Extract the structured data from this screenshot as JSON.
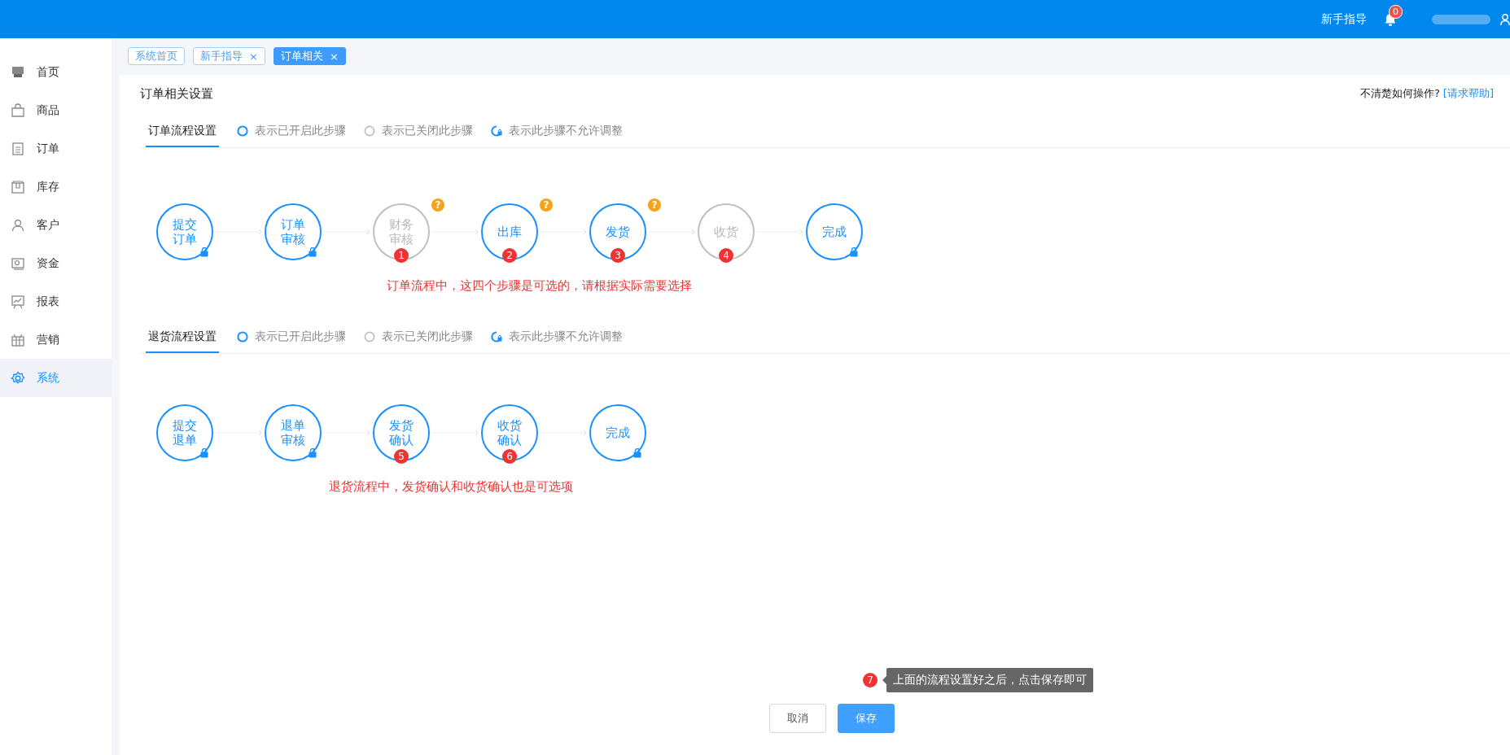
{
  "top_bar": {
    "guide_link": "新手指导",
    "notification_count": "0"
  },
  "sidebar": {
    "items": [
      {
        "label": "首页",
        "selected": false
      },
      {
        "label": "商品",
        "selected": false
      },
      {
        "label": "订单",
        "selected": false
      },
      {
        "label": "库存",
        "selected": false
      },
      {
        "label": "客户",
        "selected": false
      },
      {
        "label": "资金",
        "selected": false
      },
      {
        "label": "报表",
        "selected": false
      },
      {
        "label": "营销",
        "selected": false
      },
      {
        "label": "系统",
        "selected": true
      }
    ]
  },
  "page_tabs": [
    {
      "label": "系统首页",
      "selected": false
    },
    {
      "label": "新手指导",
      "selected": false,
      "close": "×"
    },
    {
      "label": "订单相关",
      "selected": true,
      "close": "×"
    }
  ],
  "title": "订单相关设置",
  "help": {
    "text": "不清楚如何操作?",
    "link": "[请求帮助]"
  },
  "sections": [
    {
      "tab": "订单流程设置",
      "legend": [
        {
          "kind": "on",
          "label": "表示已开启此步骤"
        },
        {
          "kind": "off",
          "label": "表示已关闭此步骤"
        },
        {
          "kind": "locked",
          "label": "表示此步骤不允许调整"
        }
      ],
      "steps": [
        {
          "label": "提交订单",
          "on": true,
          "locked": true
        },
        {
          "label": "订单审核",
          "on": true,
          "locked": true
        },
        {
          "label": "财务审核",
          "on": false,
          "locked": false,
          "help_badge": "?",
          "marker": "1"
        },
        {
          "label": "出库",
          "on": true,
          "locked": false,
          "help_badge": "?",
          "marker": "2"
        },
        {
          "label": "发货",
          "on": true,
          "locked": false,
          "help_badge": "?",
          "marker": "3"
        },
        {
          "label": "收货",
          "on": false,
          "locked": false,
          "marker": "4"
        },
        {
          "label": "完成",
          "on": true,
          "locked": true
        }
      ],
      "note": "订单流程中，这四个步骤是可选的，请根据实际需要选择"
    },
    {
      "tab": "退货流程设置",
      "legend": [
        {
          "kind": "on",
          "label": "表示已开启此步骤"
        },
        {
          "kind": "off",
          "label": "表示已关闭此步骤"
        },
        {
          "kind": "locked",
          "label": "表示此步骤不允许调整"
        }
      ],
      "steps": [
        {
          "label": "提交退单",
          "on": true,
          "locked": true
        },
        {
          "label": "退单审核",
          "on": true,
          "locked": true
        },
        {
          "label": "发货确认",
          "on": true,
          "locked": false,
          "marker": "5"
        },
        {
          "label": "收货确认",
          "on": true,
          "locked": false,
          "marker": "6"
        },
        {
          "label": "完成",
          "on": true,
          "locked": true
        }
      ],
      "note": "退货流程中，发货确认和收货确认也是可选项"
    }
  ],
  "tip": {
    "marker": "7",
    "text": "上面的流程设置好之后，点击保存即可"
  },
  "buttons": [
    {
      "label": "取消",
      "kind": "secondary"
    },
    {
      "label": "保存",
      "kind": "primary"
    }
  ]
}
